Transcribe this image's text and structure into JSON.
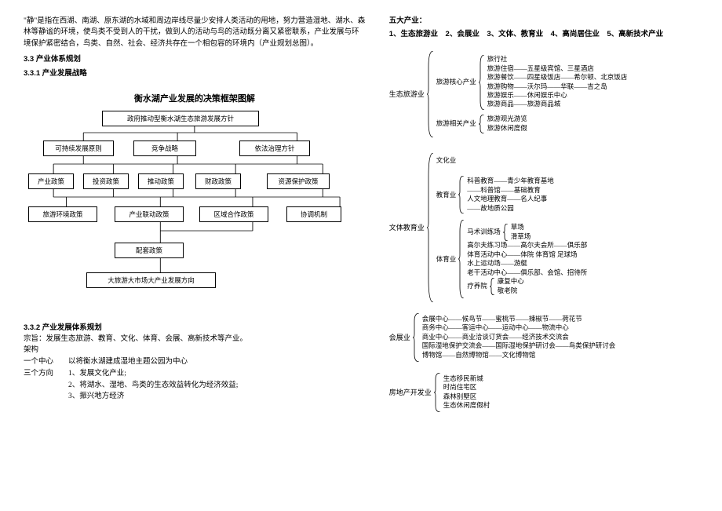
{
  "left": {
    "paragraph": "\"静\"是指在西湖、南湖、原东湖的水域和周边岸线尽量少安排人类活动的用地，努力营造湿地、湖水、森林等静谧的环境，使鸟类不受到人的干扰，做到人的活动与鸟的活动既分离又紧密联系，产业发展与环境保护紧密结合，鸟类、自然、社会、经济共存在一个相包容的环境内（产业规划总图）。",
    "h1": "3.3 产业体系规划",
    "h2": "3.3.1 产业发展战略",
    "diagram_title": "衡水湖产业发展的决策框架图解",
    "h3": "3.3.2 产业发展体系规划",
    "line_purpose": "宗旨：发展生态旅游、教育、文化、体育、会展、高新技术等产业。",
    "line_arch": "架构",
    "line_center": "一个中心　　以将衡水湖建成湿地主题公园为中心",
    "line_three": "三个方向　　1、发展文化产业;",
    "line_three2": "　　　　　　2、将湖水、湿地、鸟类的生态效益转化为经济效益;",
    "line_three3": "　　　　　　3、振兴地方经济"
  },
  "diagram": {
    "n0": "政府推动型衡水湖生态旅游发展方针",
    "n1": "可持续发展原则",
    "n2": "竞争战略",
    "n3": "依法治理方针",
    "n4": "产业政策",
    "n5": "投资政策",
    "n6": "推动政策",
    "n7": "财政政策",
    "n8": "资源保护政策",
    "n9": "旅游环境政策",
    "n10": "产业联动政策",
    "n11": "区域合作政策",
    "n12": "协调机制",
    "n13": "配套政策",
    "n14": "大旅游大市场大产业发展方向"
  },
  "right": {
    "heading1": "五大产业：",
    "heading2": "1、生态旅游业　2、会展业　3、文体、教育业　4、高尚居住业　5、高新技术产业",
    "tree1_root": "生态旅游业",
    "tree1_a_label": "旅游核心产业",
    "tree1_a1": "旅行社",
    "tree1_a2": "旅游住宿——五星级宾馆、三星酒店",
    "tree1_a3": "旅游餐饮——四星级饭店——希尔顿、北京饭店",
    "tree1_a4": "旅游购物——沃尔玛——华联——吉之岛",
    "tree1_a5": "旅游娱乐——休闲娱乐中心",
    "tree1_a6": "旅游商品——旅游商品城",
    "tree1_b_label": "旅游相关产业",
    "tree1_b1": "旅游观光游览",
    "tree1_b2": "旅游休闲度假",
    "tree2_root": "文体教育业",
    "tree2_a": "文化业",
    "tree2_b_label": "教育业",
    "tree2_b1": "科普教育——青少年教育基地",
    "tree2_b2": "——科普馆——基础教育",
    "tree2_b3": "人文地理教育——名人纪事",
    "tree2_b4": "——故地质公园",
    "tree2_c_label": "体育业",
    "tree2_c_sub_label": "马术训练场",
    "tree2_c_sub1": "草场",
    "tree2_c_sub2": "滑草场",
    "tree2_c1": "高尔夫练习场——高尔夫会所——俱乐部",
    "tree2_c2": "体育活动中心——体院 体育馆 足球场",
    "tree2_c3": "水上运动场——游艇",
    "tree2_c4": "老干活动中心——俱乐部、会馆、招待所",
    "tree2_c_liao_label": "疗养院",
    "tree2_c_liao1": "康复中心",
    "tree2_c_liao2": "敬老院",
    "tree3_root": "会展业",
    "tree3_1": "会展中心——候鸟节——蜜桃节——辣椒节——荷花节",
    "tree3_2": "商务中心——客运中心——运动中心——物流中心",
    "tree3_3": "商业中心——商业洽谈订货会——经济技术交流会",
    "tree3_4": "国际湿地保护交流会——国际湿地保护研讨会——鸟类保护研讨会",
    "tree3_5": "博物馆——自然博物馆——文化博物馆",
    "tree4_root": "房地产开发业",
    "tree4_1": "生态移民新城",
    "tree4_2": "时尚住宅区",
    "tree4_3": "森林别墅区",
    "tree4_4": "生态休闲度假村"
  },
  "chart_data": {
    "type": "diagram",
    "title": "衡水湖产业发展的决策框架图解",
    "nodes": [
      {
        "id": "n0",
        "label": "政府推动型衡水湖生态旅游发展方针",
        "row": 0
      },
      {
        "id": "n1",
        "label": "可持续发展原则",
        "row": 1
      },
      {
        "id": "n2",
        "label": "竞争战略",
        "row": 1
      },
      {
        "id": "n3",
        "label": "依法治理方针",
        "row": 1
      },
      {
        "id": "n4",
        "label": "产业政策",
        "row": 2
      },
      {
        "id": "n5",
        "label": "投资政策",
        "row": 2
      },
      {
        "id": "n6",
        "label": "推动政策",
        "row": 2
      },
      {
        "id": "n7",
        "label": "财政政策",
        "row": 2
      },
      {
        "id": "n8",
        "label": "资源保护政策",
        "row": 2
      },
      {
        "id": "n9",
        "label": "旅游环境政策",
        "row": 3
      },
      {
        "id": "n10",
        "label": "产业联动政策",
        "row": 3
      },
      {
        "id": "n11",
        "label": "区域合作政策",
        "row": 3
      },
      {
        "id": "n12",
        "label": "协调机制",
        "row": 3
      },
      {
        "id": "n13",
        "label": "配套政策",
        "row": 4
      },
      {
        "id": "n14",
        "label": "大旅游大市场大产业发展方向",
        "row": 5
      }
    ],
    "edges": [
      [
        "n0",
        "n1"
      ],
      [
        "n0",
        "n2"
      ],
      [
        "n0",
        "n3"
      ],
      [
        "n1",
        "n4"
      ],
      [
        "n1",
        "n5"
      ],
      [
        "n2",
        "n5"
      ],
      [
        "n2",
        "n6"
      ],
      [
        "n2",
        "n7"
      ],
      [
        "n3",
        "n7"
      ],
      [
        "n3",
        "n8"
      ],
      [
        "n4",
        "n9"
      ],
      [
        "n5",
        "n9"
      ],
      [
        "n5",
        "n10"
      ],
      [
        "n6",
        "n10"
      ],
      [
        "n6",
        "n11"
      ],
      [
        "n7",
        "n11"
      ],
      [
        "n7",
        "n12"
      ],
      [
        "n8",
        "n12"
      ],
      [
        "n10",
        "n13"
      ],
      [
        "n11",
        "n13"
      ],
      [
        "n13",
        "n14"
      ]
    ]
  }
}
